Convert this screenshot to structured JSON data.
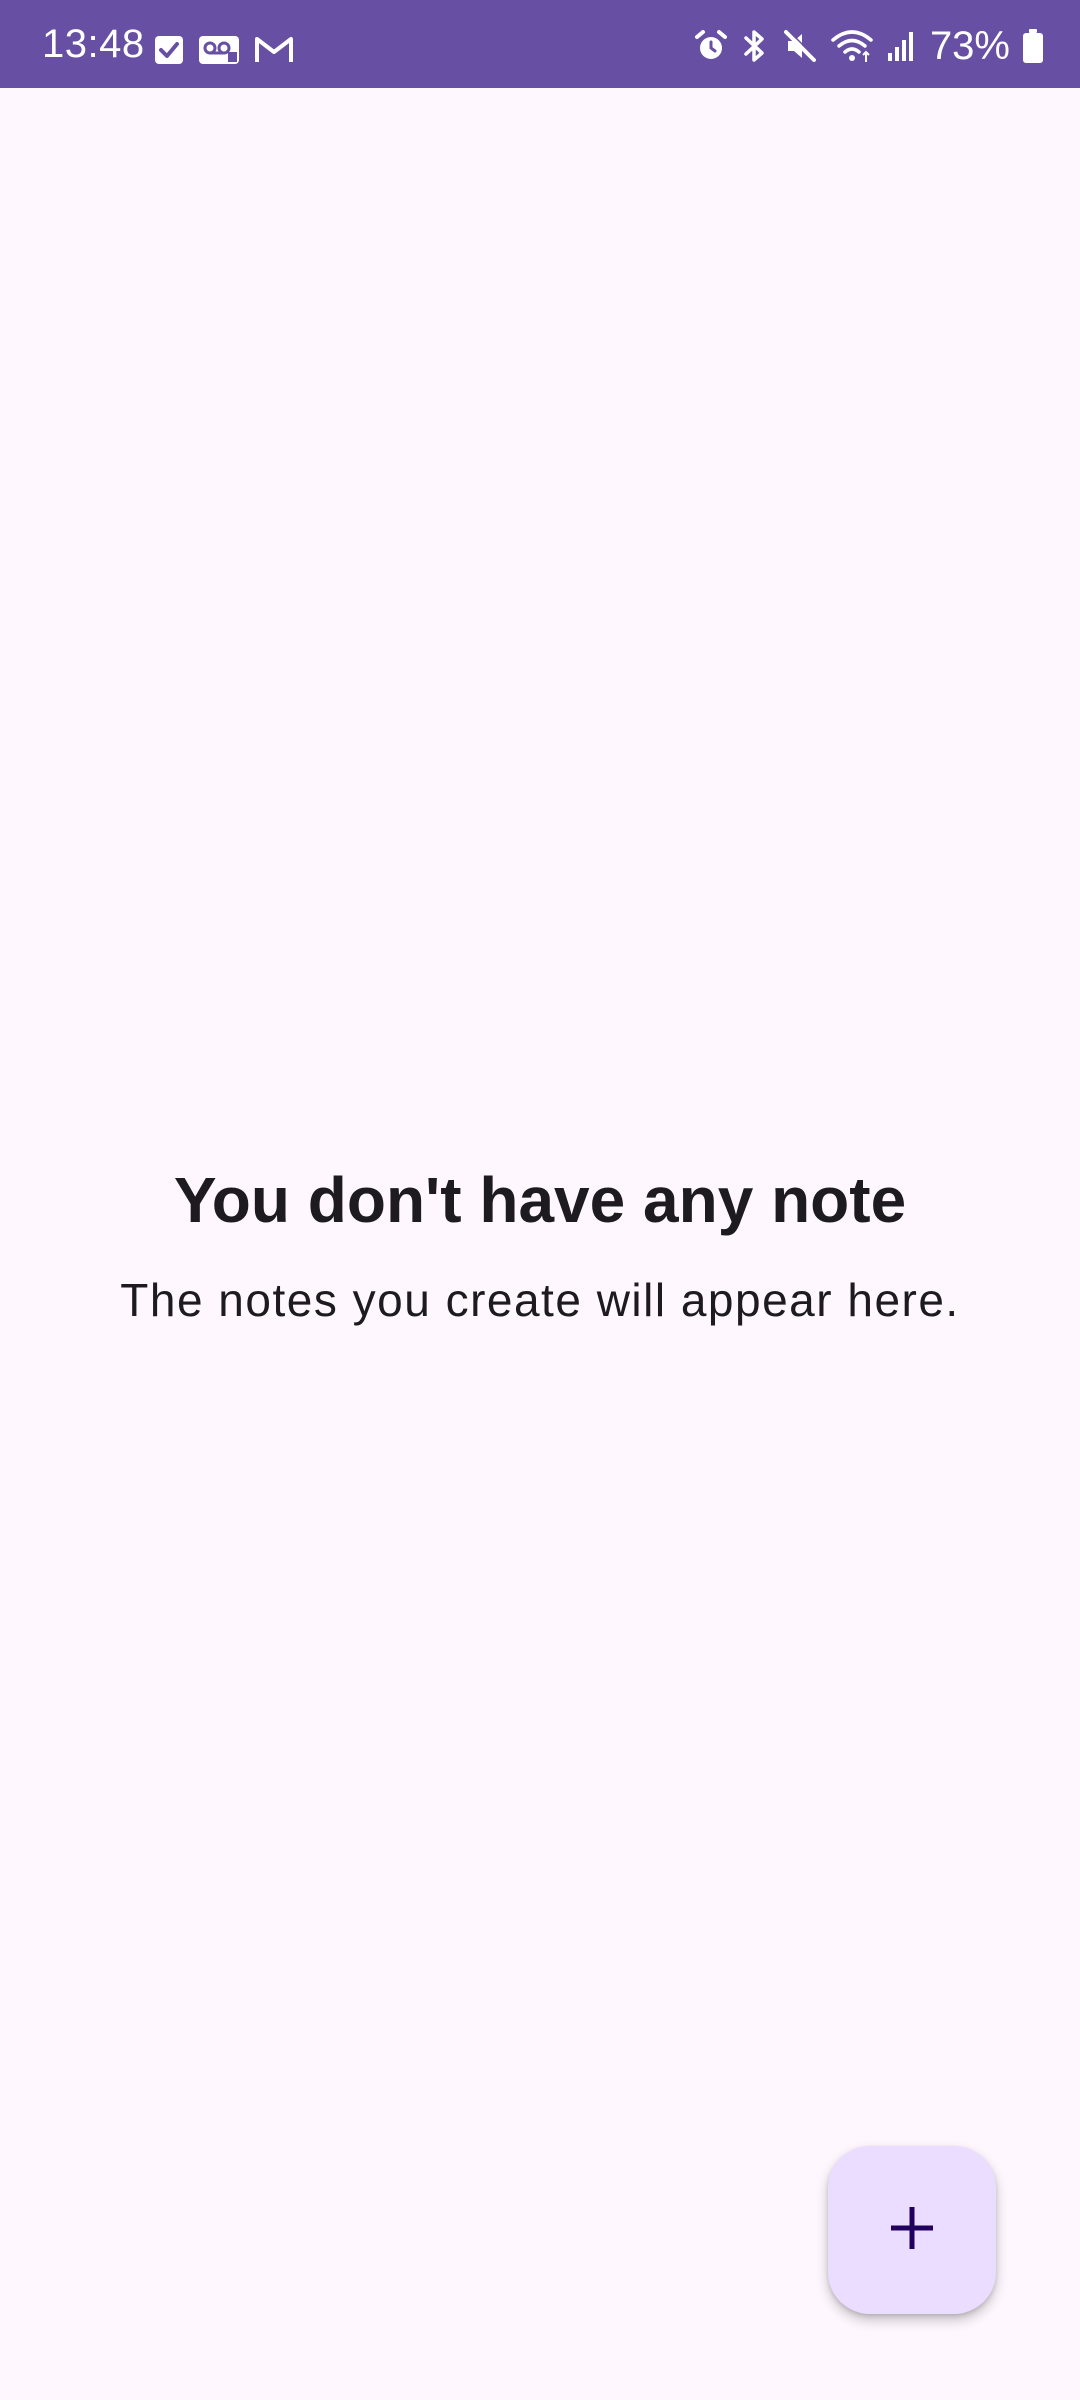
{
  "status_bar": {
    "time": "13:48",
    "battery_percent": "73%",
    "background_color": "#6750A4",
    "left_icons": [
      "task-check-icon",
      "voicemail-icon",
      "gmail-icon"
    ],
    "right_icons": [
      "alarm-icon",
      "bluetooth-icon",
      "mute-icon",
      "wifi-icon",
      "signal-icon",
      "battery-icon"
    ]
  },
  "empty_state": {
    "title": "You don't have any note",
    "subtitle": "The notes you create will appear here."
  },
  "fab": {
    "icon": "plus-icon",
    "background_color": "#EADDFF",
    "icon_color": "#21005D"
  }
}
